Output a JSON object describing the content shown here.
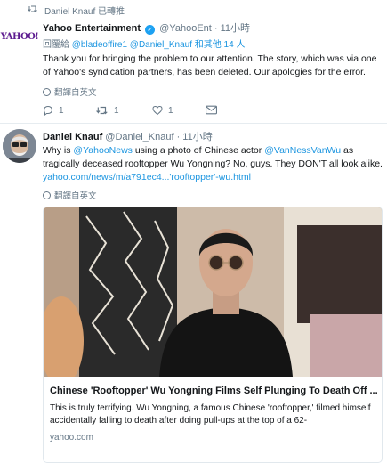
{
  "retweet_bar": {
    "label": "Daniel Knauf 已轉推"
  },
  "tweet1": {
    "avatar_logo": "YAHOO!",
    "author_name": "Yahoo Entertainment",
    "handle": "@YahooEnt",
    "time": "· 11小時",
    "reply_prefix": "回覆給 ",
    "reply_targets": "@bladeoffire1 @Daniel_Knauf 和其他 14 人",
    "text": "Thank you for bringing the problem to our attention. The story, which was via one of Yahoo's syndication partners, has been deleted. Our apologies for the error.",
    "translate": "翻譯自英文",
    "reply_count": "1",
    "retweet_count": "1",
    "like_count": "1"
  },
  "tweet2": {
    "author_name": "Daniel Knauf",
    "handle": "@Daniel_Knauf",
    "time": "· 11小時",
    "text_1": "Why is ",
    "mention_1": "@YahooNews",
    "text_2": " using a photo of Chinese actor ",
    "mention_2": "@VanNessVanWu",
    "text_3": " as tragically deceased rooftopper Wu Yongning? No, guys. They DON'T all look alike. ",
    "url": "yahoo.com/news/m/a791ec4...'rooftopper'-wu.html",
    "translate": "翻譯自英文",
    "card": {
      "title": "Chinese 'Rooftopper' Wu Yongning Films Self Plunging To Death Off ...",
      "description": "This is truly terrifying. Wu Yongning, a famous Chinese 'rooftopper,' filmed himself accidentally falling to death after doing pull-ups at the top of a 62-",
      "domain": "yahoo.com"
    }
  },
  "colors": {
    "link": "#1b95e0",
    "secondary_text": "#657786",
    "verified": "#1da1f2",
    "divider": "#e6ecf0"
  }
}
